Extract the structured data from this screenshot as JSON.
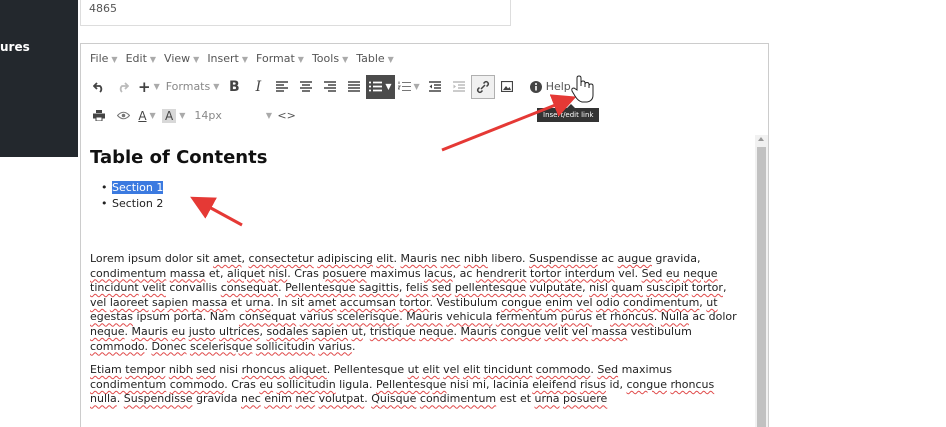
{
  "sidebar": {
    "label": "ures"
  },
  "top_input": {
    "value": "4865"
  },
  "menubar": [
    {
      "label": "File"
    },
    {
      "label": "Edit"
    },
    {
      "label": "View"
    },
    {
      "label": "Insert"
    },
    {
      "label": "Format"
    },
    {
      "label": "Tools"
    },
    {
      "label": "Table"
    }
  ],
  "toolbar": {
    "formats_label": "Formats",
    "bold_label": "B",
    "italic_label": "I",
    "help_label": "Help",
    "font_size": "14px",
    "text_color_label": "A",
    "bg_color_label": "A",
    "code_label": "<>",
    "tooltip": "Insert/edit link"
  },
  "document": {
    "heading": "Table of Contents",
    "toc": [
      "Section 1",
      "Section 2"
    ],
    "paragraph1": [
      [
        "Lorem ipsum dolor sit ",
        0
      ],
      [
        "amet",
        1
      ],
      [
        ", ",
        0
      ],
      [
        "consectetur",
        1
      ],
      [
        " ",
        0
      ],
      [
        "adipiscing",
        1
      ],
      [
        " ",
        0
      ],
      [
        "elit",
        1
      ],
      [
        ". ",
        0
      ],
      [
        "Mauris",
        1
      ],
      [
        " ",
        0
      ],
      [
        "nec",
        1
      ],
      [
        " ",
        0
      ],
      [
        "nibh",
        1
      ],
      [
        " libero. ",
        0
      ],
      [
        "Suspendisse",
        1
      ],
      [
        " ac ",
        0
      ],
      [
        "augue",
        1
      ],
      [
        " gravida, ",
        0
      ],
      [
        "condimentum",
        1
      ],
      [
        " ",
        0
      ],
      [
        "massa",
        1
      ],
      [
        " et, ",
        0
      ],
      [
        "aliquet",
        1
      ],
      [
        " ",
        0
      ],
      [
        "nisl",
        1
      ],
      [
        ". Cras ",
        0
      ],
      [
        "posuere",
        1
      ],
      [
        " maximus ",
        0
      ],
      [
        "lacus",
        1
      ],
      [
        ", ac ",
        0
      ],
      [
        "hendrerit",
        1
      ],
      [
        " ",
        0
      ],
      [
        "tortor",
        1
      ],
      [
        " ",
        0
      ],
      [
        "interdum",
        1
      ],
      [
        " vel. ",
        0
      ],
      [
        "Sed",
        1
      ],
      [
        " ",
        0
      ],
      [
        "eu",
        1
      ],
      [
        " ",
        0
      ],
      [
        "neque",
        1
      ],
      [
        " ",
        0
      ],
      [
        "tincidunt",
        1
      ],
      [
        " ",
        0
      ],
      [
        "velit",
        1
      ],
      [
        " convallis ",
        0
      ],
      [
        "consequat",
        1
      ],
      [
        ". ",
        0
      ],
      [
        "Pellentesque",
        1
      ],
      [
        " ",
        0
      ],
      [
        "sagittis",
        1
      ],
      [
        ", ",
        0
      ],
      [
        "felis",
        1
      ],
      [
        " ",
        0
      ],
      [
        "sed",
        1
      ],
      [
        " ",
        0
      ],
      [
        "pellentesque",
        1
      ],
      [
        " ",
        0
      ],
      [
        "vulputate",
        1
      ],
      [
        ", ",
        0
      ],
      [
        "nisl",
        1
      ],
      [
        " ",
        0
      ],
      [
        "quam",
        1
      ],
      [
        " ",
        0
      ],
      [
        "suscipit",
        1
      ],
      [
        " ",
        0
      ],
      [
        "tortor",
        1
      ],
      [
        ", ",
        0
      ],
      [
        "vel",
        1
      ],
      [
        " ",
        0
      ],
      [
        "laoreet",
        1
      ],
      [
        " ",
        0
      ],
      [
        "sapien",
        1
      ],
      [
        " ",
        0
      ],
      [
        "massa",
        1
      ],
      [
        " et ",
        0
      ],
      [
        "urna",
        1
      ],
      [
        ". In sit ",
        0
      ],
      [
        "amet",
        1
      ],
      [
        " ",
        0
      ],
      [
        "accumsan",
        1
      ],
      [
        " ",
        0
      ],
      [
        "tortor",
        1
      ],
      [
        ". Vestibulum ",
        0
      ],
      [
        "congue",
        1
      ],
      [
        " ",
        0
      ],
      [
        "enim",
        1
      ],
      [
        " ",
        0
      ],
      [
        "vel",
        1
      ],
      [
        " ",
        0
      ],
      [
        "odio",
        1
      ],
      [
        " ",
        0
      ],
      [
        "condimentum",
        1
      ],
      [
        ", ",
        0
      ],
      [
        "ut",
        1
      ],
      [
        " ",
        0
      ],
      [
        "egestas",
        1
      ],
      [
        " ipsum porta. Nam ",
        0
      ],
      [
        "consequat",
        1
      ],
      [
        " ",
        0
      ],
      [
        "varius",
        1
      ],
      [
        " ",
        0
      ],
      [
        "scelerisque",
        1
      ],
      [
        ". ",
        0
      ],
      [
        "Mauris",
        1
      ],
      [
        " ",
        0
      ],
      [
        "vehicula",
        1
      ],
      [
        " ",
        0
      ],
      [
        "fermentum",
        1
      ],
      [
        " ",
        0
      ],
      [
        "purus",
        1
      ],
      [
        " et ",
        0
      ],
      [
        "rhoncus",
        1
      ],
      [
        ". ",
        0
      ],
      [
        "Nulla",
        1
      ],
      [
        " ac dolor ",
        0
      ],
      [
        "neque",
        1
      ],
      [
        ". ",
        0
      ],
      [
        "Mauris",
        1
      ],
      [
        " ",
        0
      ],
      [
        "eu",
        1
      ],
      [
        " ",
        0
      ],
      [
        "justo",
        1
      ],
      [
        " ",
        0
      ],
      [
        "ultrices",
        1
      ],
      [
        ", ",
        0
      ],
      [
        "sodales",
        1
      ],
      [
        " ",
        0
      ],
      [
        "sapien",
        1
      ],
      [
        " ",
        0
      ],
      [
        "ut",
        1
      ],
      [
        ", ",
        0
      ],
      [
        "tristique",
        1
      ],
      [
        " ",
        0
      ],
      [
        "neque",
        1
      ],
      [
        ". ",
        0
      ],
      [
        "Mauris",
        1
      ],
      [
        " ",
        0
      ],
      [
        "congue",
        1
      ],
      [
        " ",
        0
      ],
      [
        "velit",
        1
      ],
      [
        " ",
        0
      ],
      [
        "vel",
        1
      ],
      [
        " ",
        0
      ],
      [
        "massa",
        1
      ],
      [
        " vestibulum ",
        0
      ],
      [
        "commodo",
        1
      ],
      [
        ". ",
        0
      ],
      [
        "Donec",
        1
      ],
      [
        " ",
        0
      ],
      [
        "scelerisque",
        1
      ],
      [
        " ",
        0
      ],
      [
        "sollicitudin",
        1
      ],
      [
        " ",
        0
      ],
      [
        "varius",
        1
      ],
      [
        ".",
        0
      ]
    ],
    "paragraph2": [
      [
        "Etiam",
        1
      ],
      [
        " ",
        0
      ],
      [
        "tempor",
        1
      ],
      [
        " ",
        0
      ],
      [
        "nibh",
        1
      ],
      [
        " ",
        0
      ],
      [
        "sed",
        1
      ],
      [
        " nisi ",
        0
      ],
      [
        "rhoncus",
        1
      ],
      [
        " ",
        0
      ],
      [
        "aliquet",
        1
      ],
      [
        ". Pellentesque ",
        0
      ],
      [
        "ut",
        1
      ],
      [
        " ",
        0
      ],
      [
        "elit",
        1
      ],
      [
        " ",
        0
      ],
      [
        "vel",
        1
      ],
      [
        " ",
        0
      ],
      [
        "elit",
        1
      ],
      [
        " ",
        0
      ],
      [
        "tincidunt",
        1
      ],
      [
        " ",
        0
      ],
      [
        "commodo",
        1
      ],
      [
        ". ",
        0
      ],
      [
        "Sed",
        1
      ],
      [
        " maximus ",
        0
      ],
      [
        "condimentum",
        1
      ],
      [
        " ",
        0
      ],
      [
        "commodo",
        1
      ],
      [
        ". Cras ",
        0
      ],
      [
        "eu",
        1
      ],
      [
        " ",
        0
      ],
      [
        "sollicitudin",
        1
      ],
      [
        " ligula. ",
        0
      ],
      [
        "Pellentesque",
        1
      ],
      [
        " nisi mi, lacinia ",
        0
      ],
      [
        "eleifend",
        1
      ],
      [
        " ",
        0
      ],
      [
        "risus",
        1
      ],
      [
        " id, ",
        0
      ],
      [
        "congue",
        1
      ],
      [
        " ",
        0
      ],
      [
        "rhoncus",
        1
      ],
      [
        " ",
        0
      ],
      [
        "nulla",
        1
      ],
      [
        ". ",
        0
      ],
      [
        "Suspendisse",
        1
      ],
      [
        " gravida ",
        0
      ],
      [
        "nec",
        1
      ],
      [
        " ",
        0
      ],
      [
        "enim",
        1
      ],
      [
        " ",
        0
      ],
      [
        "nec",
        1
      ],
      [
        " ",
        0
      ],
      [
        "volutpat",
        1
      ],
      [
        ". ",
        0
      ],
      [
        "Quisque",
        1
      ],
      [
        " ",
        0
      ],
      [
        "condimentum",
        1
      ],
      [
        " est et ",
        0
      ],
      [
        "urna",
        1
      ],
      [
        " ",
        0
      ],
      [
        "posuere",
        1
      ]
    ]
  },
  "colors": {
    "sidebar_bg": "#23282d",
    "active_button": "#4b4b4b",
    "selection": "#3b7ae0",
    "arrow": "#e53935",
    "tooltip_bg": "#333333",
    "spellcheck": "#e04a4a"
  }
}
